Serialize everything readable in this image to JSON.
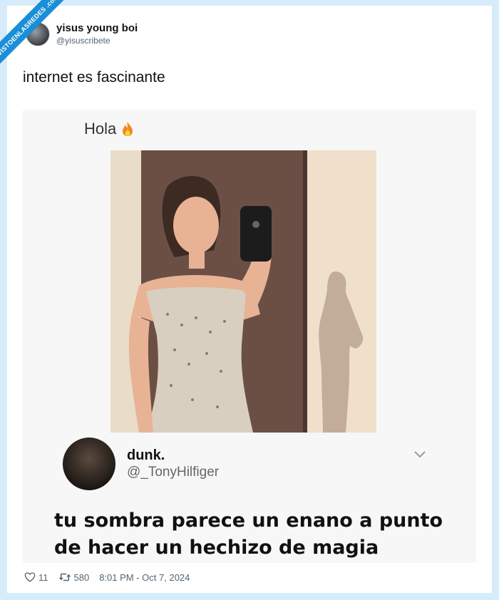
{
  "watermark": {
    "text": "VISTOENLASREDES .com"
  },
  "author": {
    "display_name": "yisus young boi",
    "handle": "@yisuscribete"
  },
  "tweet": {
    "text": "internet es fascinante"
  },
  "media": {
    "caption": "Hola",
    "caption_emoji": "fire-icon",
    "reply": {
      "display_name": "dunk.",
      "handle": "@_TonyHilfiger",
      "text": "tu sombra parece un enano a punto de hacer un hechizo de magia"
    }
  },
  "footer": {
    "likes": "11",
    "retweets": "580",
    "timestamp": "8:01 PM - Oct 7, 2024"
  },
  "colors": {
    "background": "#d6ecfa",
    "watermark": "#1a8fd6",
    "meta": "#536471"
  }
}
